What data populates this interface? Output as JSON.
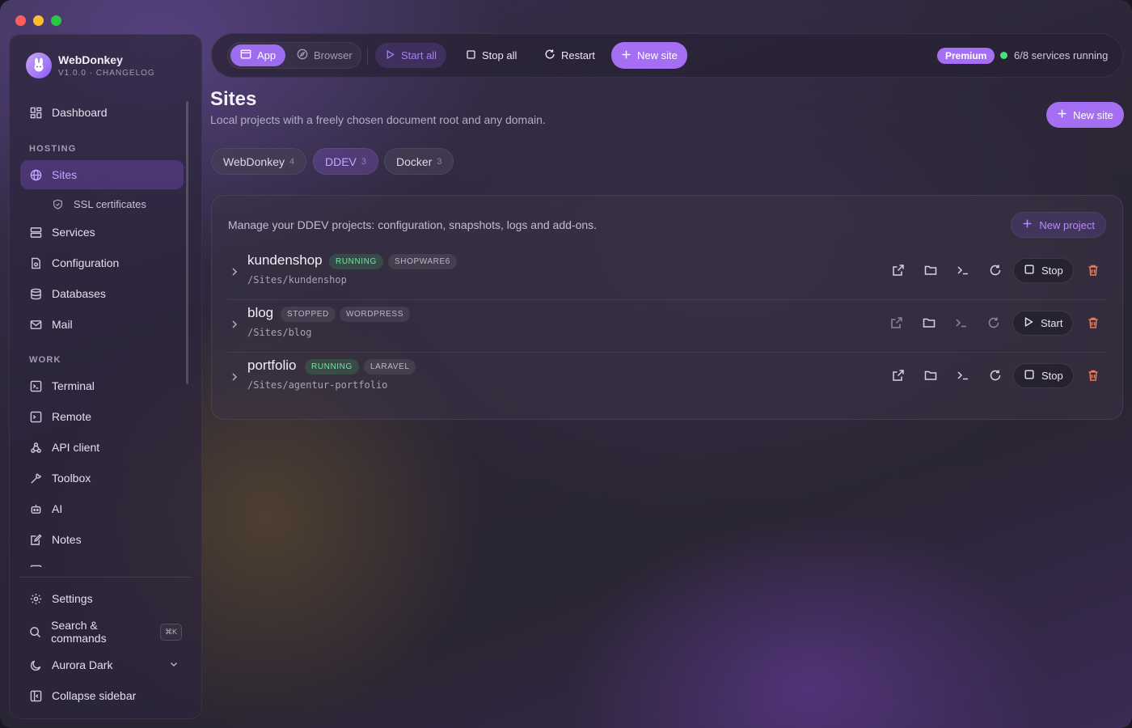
{
  "app": {
    "name": "WebDonkey",
    "version": "V1.0.0 · CHANGELOG"
  },
  "sidebar": {
    "dashboard": "Dashboard",
    "section_hosting": "HOSTING",
    "sites": "Sites",
    "ssl": "SSL certificates",
    "services": "Services",
    "configuration": "Configuration",
    "databases": "Databases",
    "mail": "Mail",
    "section_work": "WORK",
    "terminal": "Terminal",
    "remote": "Remote",
    "api_client": "API client",
    "toolbox": "Toolbox",
    "ai": "AI",
    "notes": "Notes",
    "settings": "Settings",
    "search": "Search & commands",
    "search_kbd": "⌘K",
    "theme": "Aurora Dark",
    "collapse": "Collapse sidebar"
  },
  "toolbar": {
    "app": "App",
    "browser": "Browser",
    "start_all": "Start all",
    "stop_all": "Stop all",
    "restart": "Restart",
    "new_site": "New site",
    "premium": "Premium",
    "status": "6/8 services running"
  },
  "page": {
    "title": "Sites",
    "subtitle": "Local projects with a freely chosen document root and any domain.",
    "new_site": "New site"
  },
  "tabs": [
    {
      "label": "WebDonkey",
      "count": "4"
    },
    {
      "label": "DDEV",
      "count": "3"
    },
    {
      "label": "Docker",
      "count": "3"
    }
  ],
  "card": {
    "description": "Manage your DDEV projects: configuration, snapshots, logs and add-ons.",
    "new_project": "New project"
  },
  "projects": [
    {
      "name": "kundenshop",
      "status": "RUNNING",
      "type": "SHOPWARE6",
      "path": "/Sites/kundenshop",
      "action": "Stop"
    },
    {
      "name": "blog",
      "status": "STOPPED",
      "type": "WORDPRESS",
      "path": "/Sites/blog",
      "action": "Start"
    },
    {
      "name": "portfolio",
      "status": "RUNNING",
      "type": "LARAVEL",
      "path": "/Sites/agentur-portfolio",
      "action": "Stop"
    }
  ],
  "colors": {
    "accent": "#a46ff2",
    "running": "#6ee7a0",
    "danger": "#f07a52"
  }
}
